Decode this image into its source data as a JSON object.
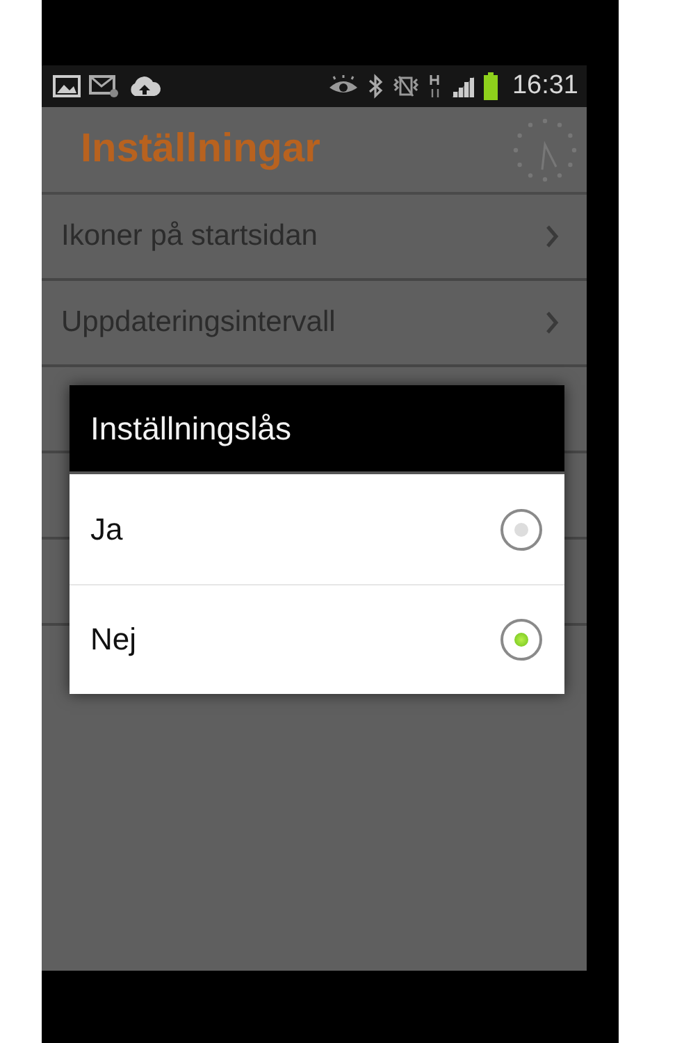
{
  "status_bar": {
    "time": "16:31"
  },
  "app_bar": {
    "title": "Inställningar"
  },
  "settings_items": [
    {
      "label": "Ikoner på startsidan"
    },
    {
      "label": "Uppdateringsintervall"
    }
  ],
  "dialog": {
    "title": "Inställningslås",
    "options": [
      {
        "label": "Ja",
        "selected": false
      },
      {
        "label": "Nej",
        "selected": true
      }
    ]
  }
}
